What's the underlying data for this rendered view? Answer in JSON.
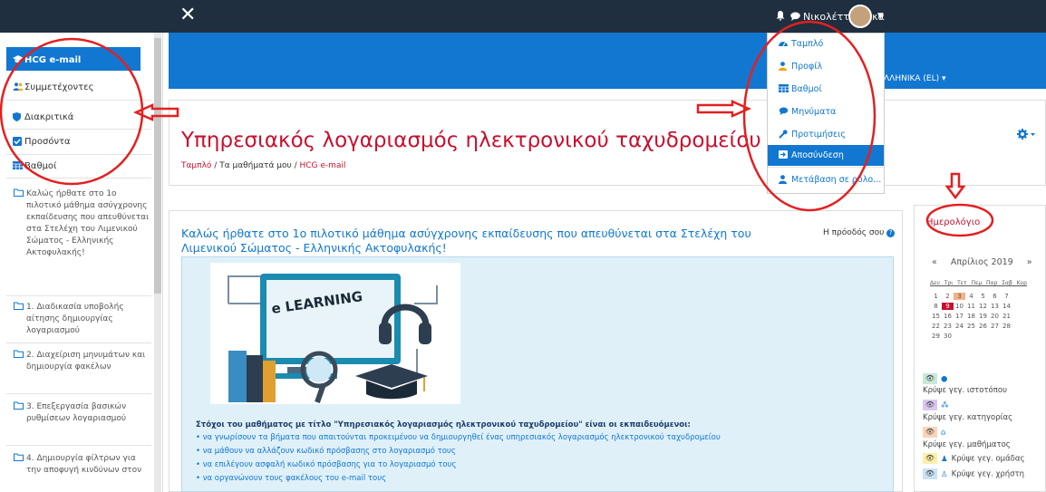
{
  "topbar": {
    "close_glyph": "✕",
    "user_name": "Νικολέττα Κάκα",
    "bell_icon": "bell-icon",
    "chat_icon": "chat-icon"
  },
  "sidebar": {
    "active": {
      "label": "HCG e-mail",
      "icon": "graduation-cap-icon"
    },
    "items": [
      {
        "label": "Συμμετέχοντες",
        "icon": "users-icon"
      },
      {
        "label": "Διακριτικά",
        "icon": "shield-icon"
      },
      {
        "label": "Προσόντα",
        "icon": "checkbox-icon"
      },
      {
        "label": "Βαθμοί",
        "icon": "table-icon"
      }
    ],
    "folders": [
      "Καλώς ήρθατε στο 1ο πιλοτικό μάθημα ασύγχρονης εκπαίδευσης που απευθύνεται στα Στελέχη του Λιμενικού Σώματος - Ελληνικής Ακτοφυλακής!",
      "1. Διαδικασία υποβολής αίτησης δημιουργίας λογαριασμού",
      "2. Διαχείριση μηνυμάτων και δημιουργία φακέλων",
      "3. Επεξεργασία βασικών ρυθμίσεων λογαριασμού",
      "4. Δημιουργία φίλτρων για την αποφυγή κινδύνων στον"
    ]
  },
  "header": {
    "language": "ΛΛΗΝΙΚΑ (EL) ▾"
  },
  "page": {
    "title": "Υπηρεσιακός λογαριασμός ηλεκτρονικού ταχυδρομείου",
    "breadcrumb": [
      "Ταμπλό",
      "Τα μαθήματά μου",
      "HCG e-mail"
    ],
    "breadcrumb_sep": "/"
  },
  "content": {
    "welcome": "Καλώς ήρθατε στο 1ο πιλοτικό μάθημα ασύγχρονης εκπαίδευσης που απευθύνεται στα Στελέχη του Λιμενικού Σώματος - Ελληνικής Ακτοφυλακής!",
    "progress_label": "Η πρόοδός σου",
    "image_label": "e LEARNING",
    "goals_title": "Στόχοι του μαθήματος με τίτλο \"Υπηρεσιακός λογαριασμός ηλεκτρονικού ταχυδρομείου\" είναι οι εκπαιδευόμενοι:",
    "goals": [
      "να γνωρίσουν τα βήματα που απαιτούνται προκειμένου να δημιουργηθεί ένας υπηρεσιακός λογαριασμός ηλεκτρονικού ταχυδρομείου",
      "να μάθουν να αλλάζουν κωδικό πρόσβασης στο λογαριασμό τους",
      "να επιλέγουν ασφαλή κωδικό πρόσβασης για το λογαριασμό τους",
      "να οργανώνουν τους φακέλους του e-mail τους"
    ]
  },
  "user_menu": {
    "items": [
      {
        "label": "Ταμπλό",
        "icon": "dashboard-icon"
      },
      {
        "label": "Προφίλ",
        "icon": "user-icon"
      },
      {
        "label": "Βαθμοί",
        "icon": "table-icon"
      },
      {
        "label": "Μηνύματα",
        "icon": "chat-icon"
      },
      {
        "label": "Προτιμήσεις",
        "icon": "wrench-icon"
      },
      {
        "label": "Αποσύνδεση",
        "icon": "logout-icon"
      },
      {
        "label": "Μετάβαση σε ρόλο...",
        "icon": "user-switch-icon"
      }
    ],
    "active_index": 5
  },
  "calendar": {
    "title": "Ημερολόγιο",
    "month": "Απρίλιος 2019",
    "prev": "«",
    "next": "»",
    "dow": "Δευ Τρι Τετ Πεμ Παρ Σαβ Κυρ",
    "weeks": [
      [
        "1",
        "2",
        "3",
        "4",
        "5",
        "6",
        "7"
      ],
      [
        "8",
        "9",
        "10",
        "11",
        "12",
        "13",
        "14"
      ],
      [
        "15",
        "16",
        "17",
        "18",
        "19",
        "20",
        "21"
      ],
      [
        "22",
        "23",
        "24",
        "25",
        "26",
        "27",
        "28"
      ],
      [
        "29",
        "30",
        "",
        "",
        "",
        "",
        ""
      ]
    ],
    "today": "9",
    "event_day": "3",
    "legend": [
      {
        "label": "Κρύψε γεγ. ιστοτόπου",
        "icons": [
          "eye-icon",
          "globe-icon"
        ],
        "color": "#c9e8d9"
      },
      {
        "label": "Κρύψε γεγ. κατηγορίας",
        "icons": [
          "eye-icon",
          "cubes-icon"
        ],
        "color": "#d8c8f0"
      },
      {
        "label": "Κρύψε γεγ. μαθήματος",
        "icons": [
          "eye-icon",
          "building-icon"
        ],
        "color": "#fbd4b8"
      },
      {
        "label": "Κρύψε γεγ. ομάδας",
        "icons": [
          "eye-icon",
          "users-icon"
        ],
        "color": "#fff0a8"
      },
      {
        "label": "Κρύψε γεγ. χρήστη",
        "icons": [
          "eye-icon",
          "user-icon"
        ],
        "color": "#c9e2f5"
      }
    ]
  },
  "colors": {
    "brand": "#1177d1",
    "topbar": "#1f2f3f",
    "title_red": "#c8102e",
    "annotation_red": "#e32020"
  }
}
